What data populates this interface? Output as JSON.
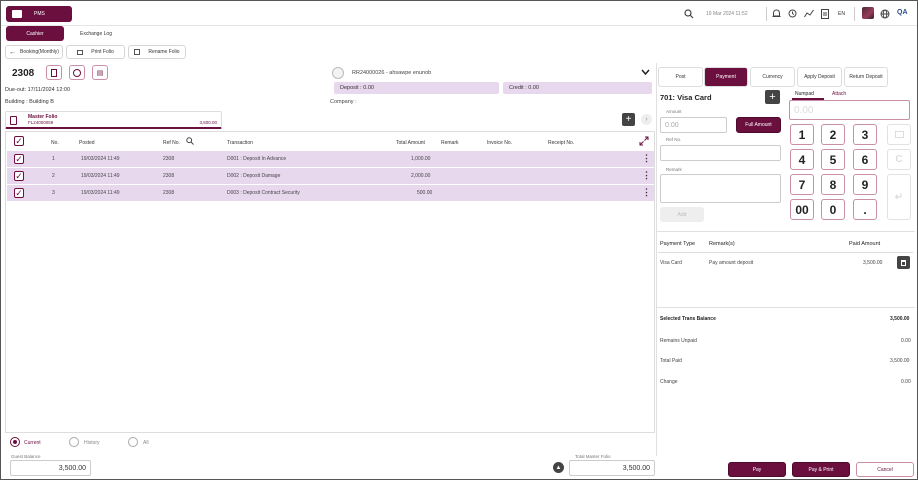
{
  "app": {
    "pms_label": "PMS",
    "date_time": "19 Mar 2024 11:52",
    "language": "EN",
    "user_initials": "QA"
  },
  "nav": {
    "cashier_tab": "Cashier",
    "exchange_tab": "Exchange Log"
  },
  "toolbar": {
    "back_label": "Booking(Monthly)",
    "print_folio": "Print Folio",
    "rename_folio": "Rename Folio"
  },
  "room": {
    "number": "2308",
    "due_out": "Due-out: 17/11/2024 12:00",
    "building": "Building : Building B"
  },
  "folio": {
    "name": "Master Folio",
    "code": "FL24000059",
    "amount": "3,500.00"
  },
  "reservation": {
    "id": "RR24000026 - ahsawpe enunob",
    "deposit": "Deposit : 0.00",
    "credit": "Credit : 0.00",
    "company": "Company :"
  },
  "table": {
    "headers": [
      "No.",
      "Posted",
      "Ref No.",
      "Transaction",
      "Total Amount",
      "Remark",
      "Invoice No.",
      "Receipt No."
    ],
    "rows": [
      {
        "no": "1",
        "posted": "19/03/2024 11:49",
        "ref": "2308",
        "transaction": "D001 : Deposit In Advance",
        "amount": "1,000.00"
      },
      {
        "no": "2",
        "posted": "19/03/2024 11:49",
        "ref": "2308",
        "transaction": "D002 : Deposit Damage",
        "amount": "2,000.00"
      },
      {
        "no": "3",
        "posted": "19/03/2024 11:49",
        "ref": "2308",
        "transaction": "D003 : Deposit Contract Security",
        "amount": "500.00"
      }
    ]
  },
  "filters": {
    "current": "Current",
    "history": "History",
    "all": "All"
  },
  "footer": {
    "guest_balance_label": "Guest Balance",
    "guest_balance": "3,500.00",
    "total_master_label": "Total Master Folio",
    "total_master": "3,500.00"
  },
  "payment": {
    "tabs": [
      "Post",
      "Payment",
      "Currency",
      "Apply Deposit",
      "Return Deposit"
    ],
    "method_title": "701: Visa Card",
    "amount_label": "Amount",
    "amount_placeholder": "0.00",
    "full_amount": "Full Amount",
    "ref_label": "Ref No.",
    "remark_label": "Remark",
    "add_label": "Add",
    "numpad_tab": "Numpad",
    "attach_tab": "Attach",
    "numpad_display": "0.00",
    "keys": [
      "1",
      "2",
      "3",
      "4",
      "5",
      "6",
      "7",
      "8",
      "9",
      "00",
      "0",
      "."
    ],
    "list_headers": {
      "type": "Payment Type",
      "remark": "Remark(s)",
      "amount": "Paid Amount"
    },
    "list_row": {
      "type": "Visa Card",
      "remark": "Pay amount deposit",
      "amount": "3,500.00"
    },
    "summary": [
      {
        "label": "Selected Trans Balance",
        "value": "3,500.00"
      },
      {
        "label": "Remains Unpaid",
        "value": "0.00"
      },
      {
        "label": "Total Paid",
        "value": "3,500.00"
      },
      {
        "label": "Change",
        "value": "0.00"
      }
    ],
    "pay": "Pay",
    "pay_print": "Pay & Print",
    "cancel": "Cancel"
  },
  "colors": {
    "brand": "#6b0f3f",
    "row_highlight": "#e8d8ee",
    "info_bar": "#e8d8ee"
  }
}
